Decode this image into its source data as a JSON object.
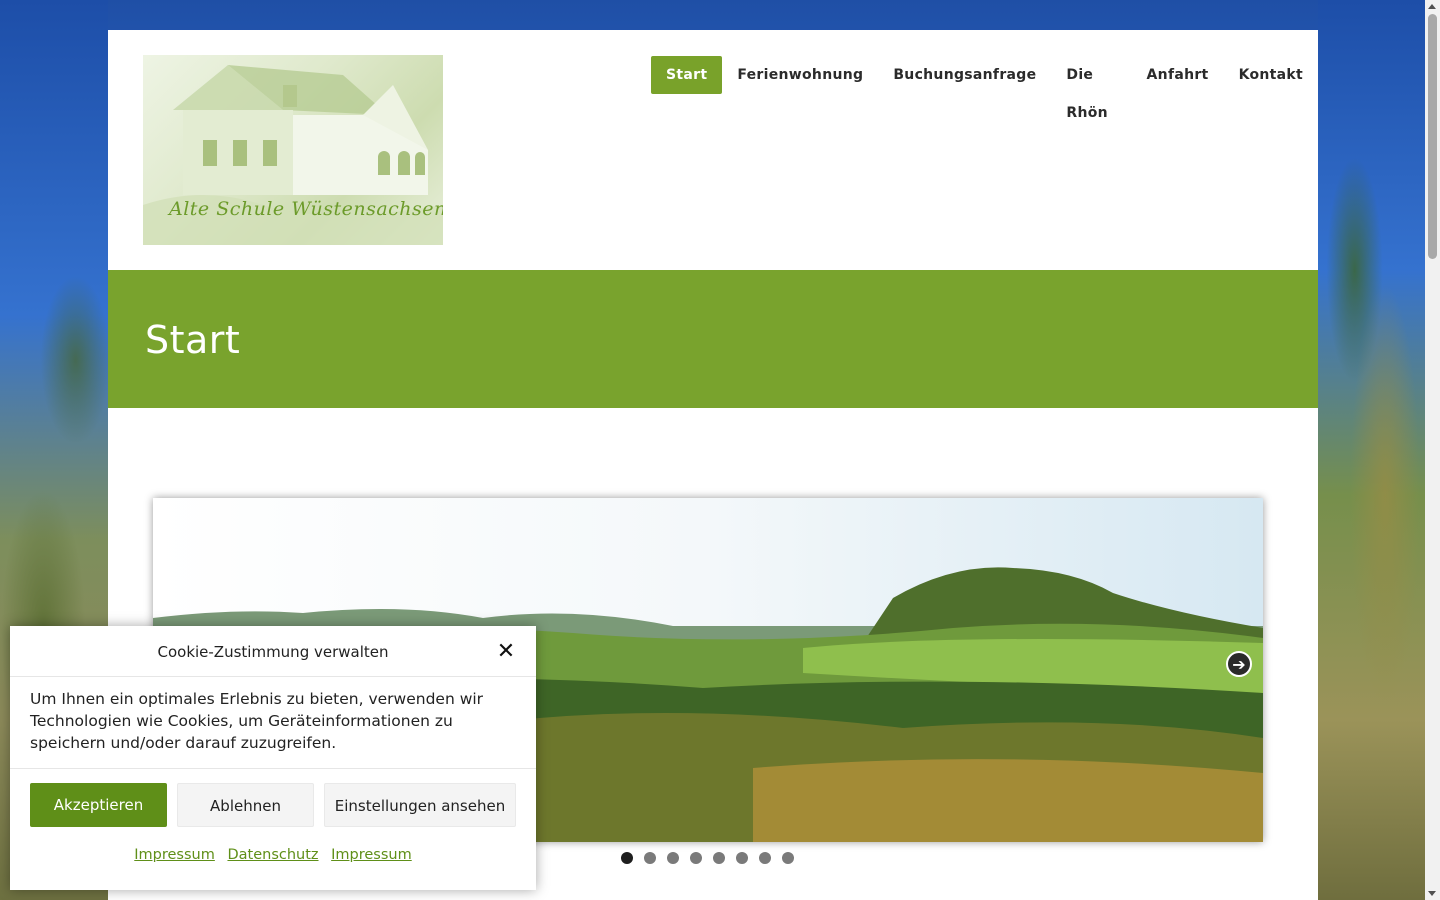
{
  "nav": {
    "items": [
      {
        "label": "Start",
        "active": true
      },
      {
        "label": "Ferienwohnung"
      },
      {
        "label": "Buchungsanfrage"
      },
      {
        "label": "Die Rhön"
      },
      {
        "label": "Anfahrt"
      },
      {
        "label": "Kontakt"
      }
    ]
  },
  "logo": {
    "text": "Alte Schule Wüstensachsen"
  },
  "banner": {
    "title": "Start"
  },
  "slider": {
    "next_icon": "arrow-right-icon",
    "dots_count": 8,
    "active_dot": 1
  },
  "cookie": {
    "title": "Cookie-Zustimmung verwalten",
    "close_icon": "close-icon",
    "message": "Um Ihnen ein optimales Erlebnis zu bieten, verwenden wir Technologien wie Cookies, um Geräteinformationen zu speichern und/oder darauf zuzugreifen.",
    "accept_label": "Akzeptieren",
    "deny_label": "Ablehnen",
    "settings_label": "Einstellungen ansehen",
    "links": [
      "Impressum",
      "Datenschutz",
      "Impressum"
    ]
  },
  "colors": {
    "accent": "#79a22a",
    "cookie_accent": "#5f8f18"
  }
}
